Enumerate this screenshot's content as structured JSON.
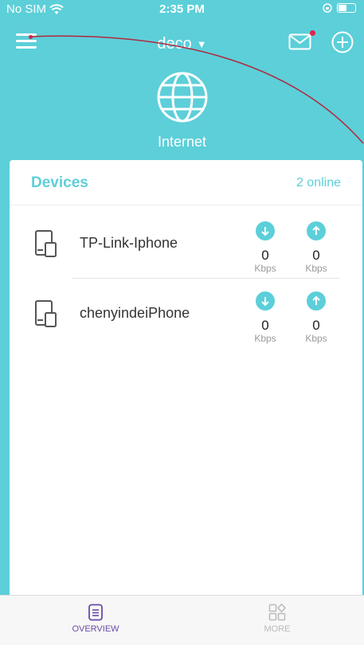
{
  "status_bar": {
    "carrier": "No SIM",
    "time": "2:35 PM"
  },
  "header": {
    "network_name": "deco",
    "internet_label": "Internet"
  },
  "devices_card": {
    "title": "Devices",
    "online_count": "2 online",
    "devices": [
      {
        "name": "TP-Link-Iphone",
        "download": "0",
        "download_unit": "Kbps",
        "upload": "0",
        "upload_unit": "Kbps"
      },
      {
        "name": "chenyindeiPhone",
        "download": "0",
        "download_unit": "Kbps",
        "upload": "0",
        "upload_unit": "Kbps"
      }
    ]
  },
  "bottom_nav": {
    "overview": "OVERVIEW",
    "more": "MORE"
  },
  "colors": {
    "accent": "#5ccfd9",
    "active_tab": "#6b4aa6",
    "notification": "#e0224a"
  }
}
